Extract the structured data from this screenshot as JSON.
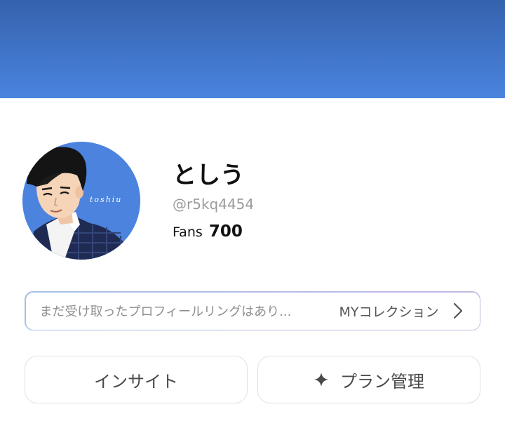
{
  "profile": {
    "name": "としう",
    "handle": "@r5kq4454",
    "fans_label": "Fans",
    "fans_count": "700",
    "avatar_signature": "toshiu"
  },
  "collection_bar": {
    "message": "まだ受け取ったプロフィールリングはあり...",
    "link_label": "MYコレクション"
  },
  "actions": {
    "insight_label": "インサイト",
    "plan_label": "プラン管理"
  },
  "colors": {
    "cover_top": "#3562ad",
    "cover_bottom": "#4a84df",
    "text_primary": "#111111",
    "text_muted": "#9a9a9a"
  },
  "icons": {
    "collection_chevron": "chevron-right-icon",
    "plan_icon": "sparkle-icon"
  }
}
